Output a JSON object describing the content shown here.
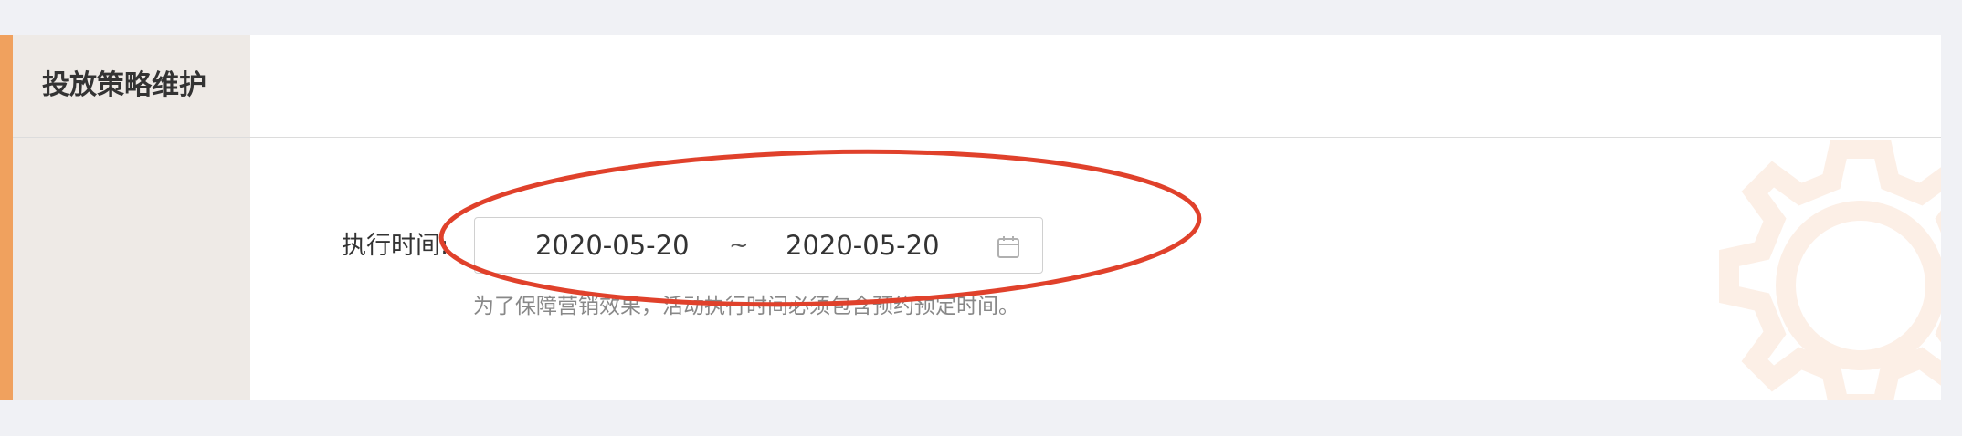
{
  "section": {
    "title": "投放策略维护"
  },
  "form": {
    "execution_time": {
      "label": "执行时间:",
      "start_date": "2020-05-20",
      "separator": "~",
      "end_date": "2020-05-20",
      "hint": "为了保障营销效果，活动执行时间必须包含预约预定时间。"
    }
  },
  "colors": {
    "accent": "#f0a15e",
    "annotation": "#e0412b",
    "left_column_bg": "#eeeae6",
    "page_bg": "#f0f1f5"
  },
  "icons": {
    "calendar": "calendar-icon",
    "watermark": "gear-watermark-icon"
  }
}
